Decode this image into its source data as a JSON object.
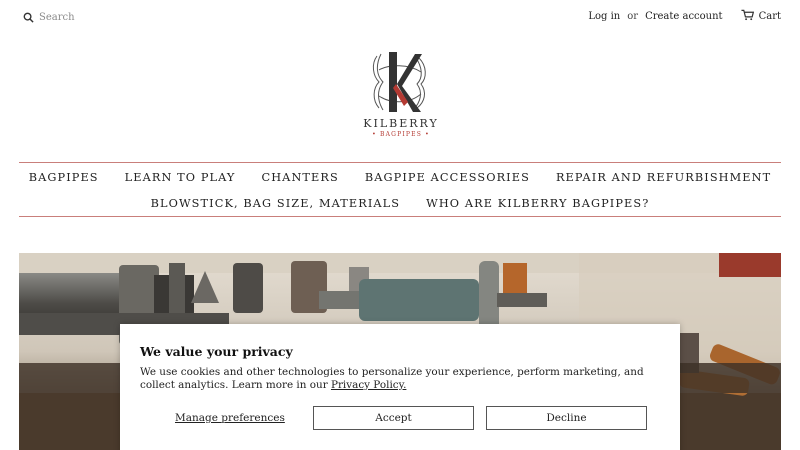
{
  "header": {
    "search_placeholder": "Search",
    "login_label": "Log in",
    "or_text": "or",
    "create_account_label": "Create account",
    "cart_label": "Cart"
  },
  "logo": {
    "name": "KILBERRY",
    "tagline": "• BAGPIPES •",
    "accent_color": "#b43a33"
  },
  "nav": {
    "row1": [
      "BAGPIPES",
      "LEARN TO PLAY",
      "CHANTERS",
      "BAGPIPE ACCESSORIES",
      "REPAIR AND REFURBISHMENT"
    ],
    "row2": [
      "BLOWSTICK, BAG SIZE, MATERIALS",
      "WHO ARE KILBERRY BAGPIPES?"
    ]
  },
  "privacy": {
    "title": "We value your privacy",
    "body": "We use cookies and other technologies to personalize your experience, perform marketing, and collect analytics. Learn more in our ",
    "policy_link": "Privacy Policy.",
    "manage_label": "Manage preferences",
    "accept_label": "Accept",
    "decline_label": "Decline"
  },
  "colors": {
    "divider": "#c97f7b",
    "text": "#222222"
  },
  "icons": {
    "search": "search-icon",
    "cart": "cart-icon"
  }
}
